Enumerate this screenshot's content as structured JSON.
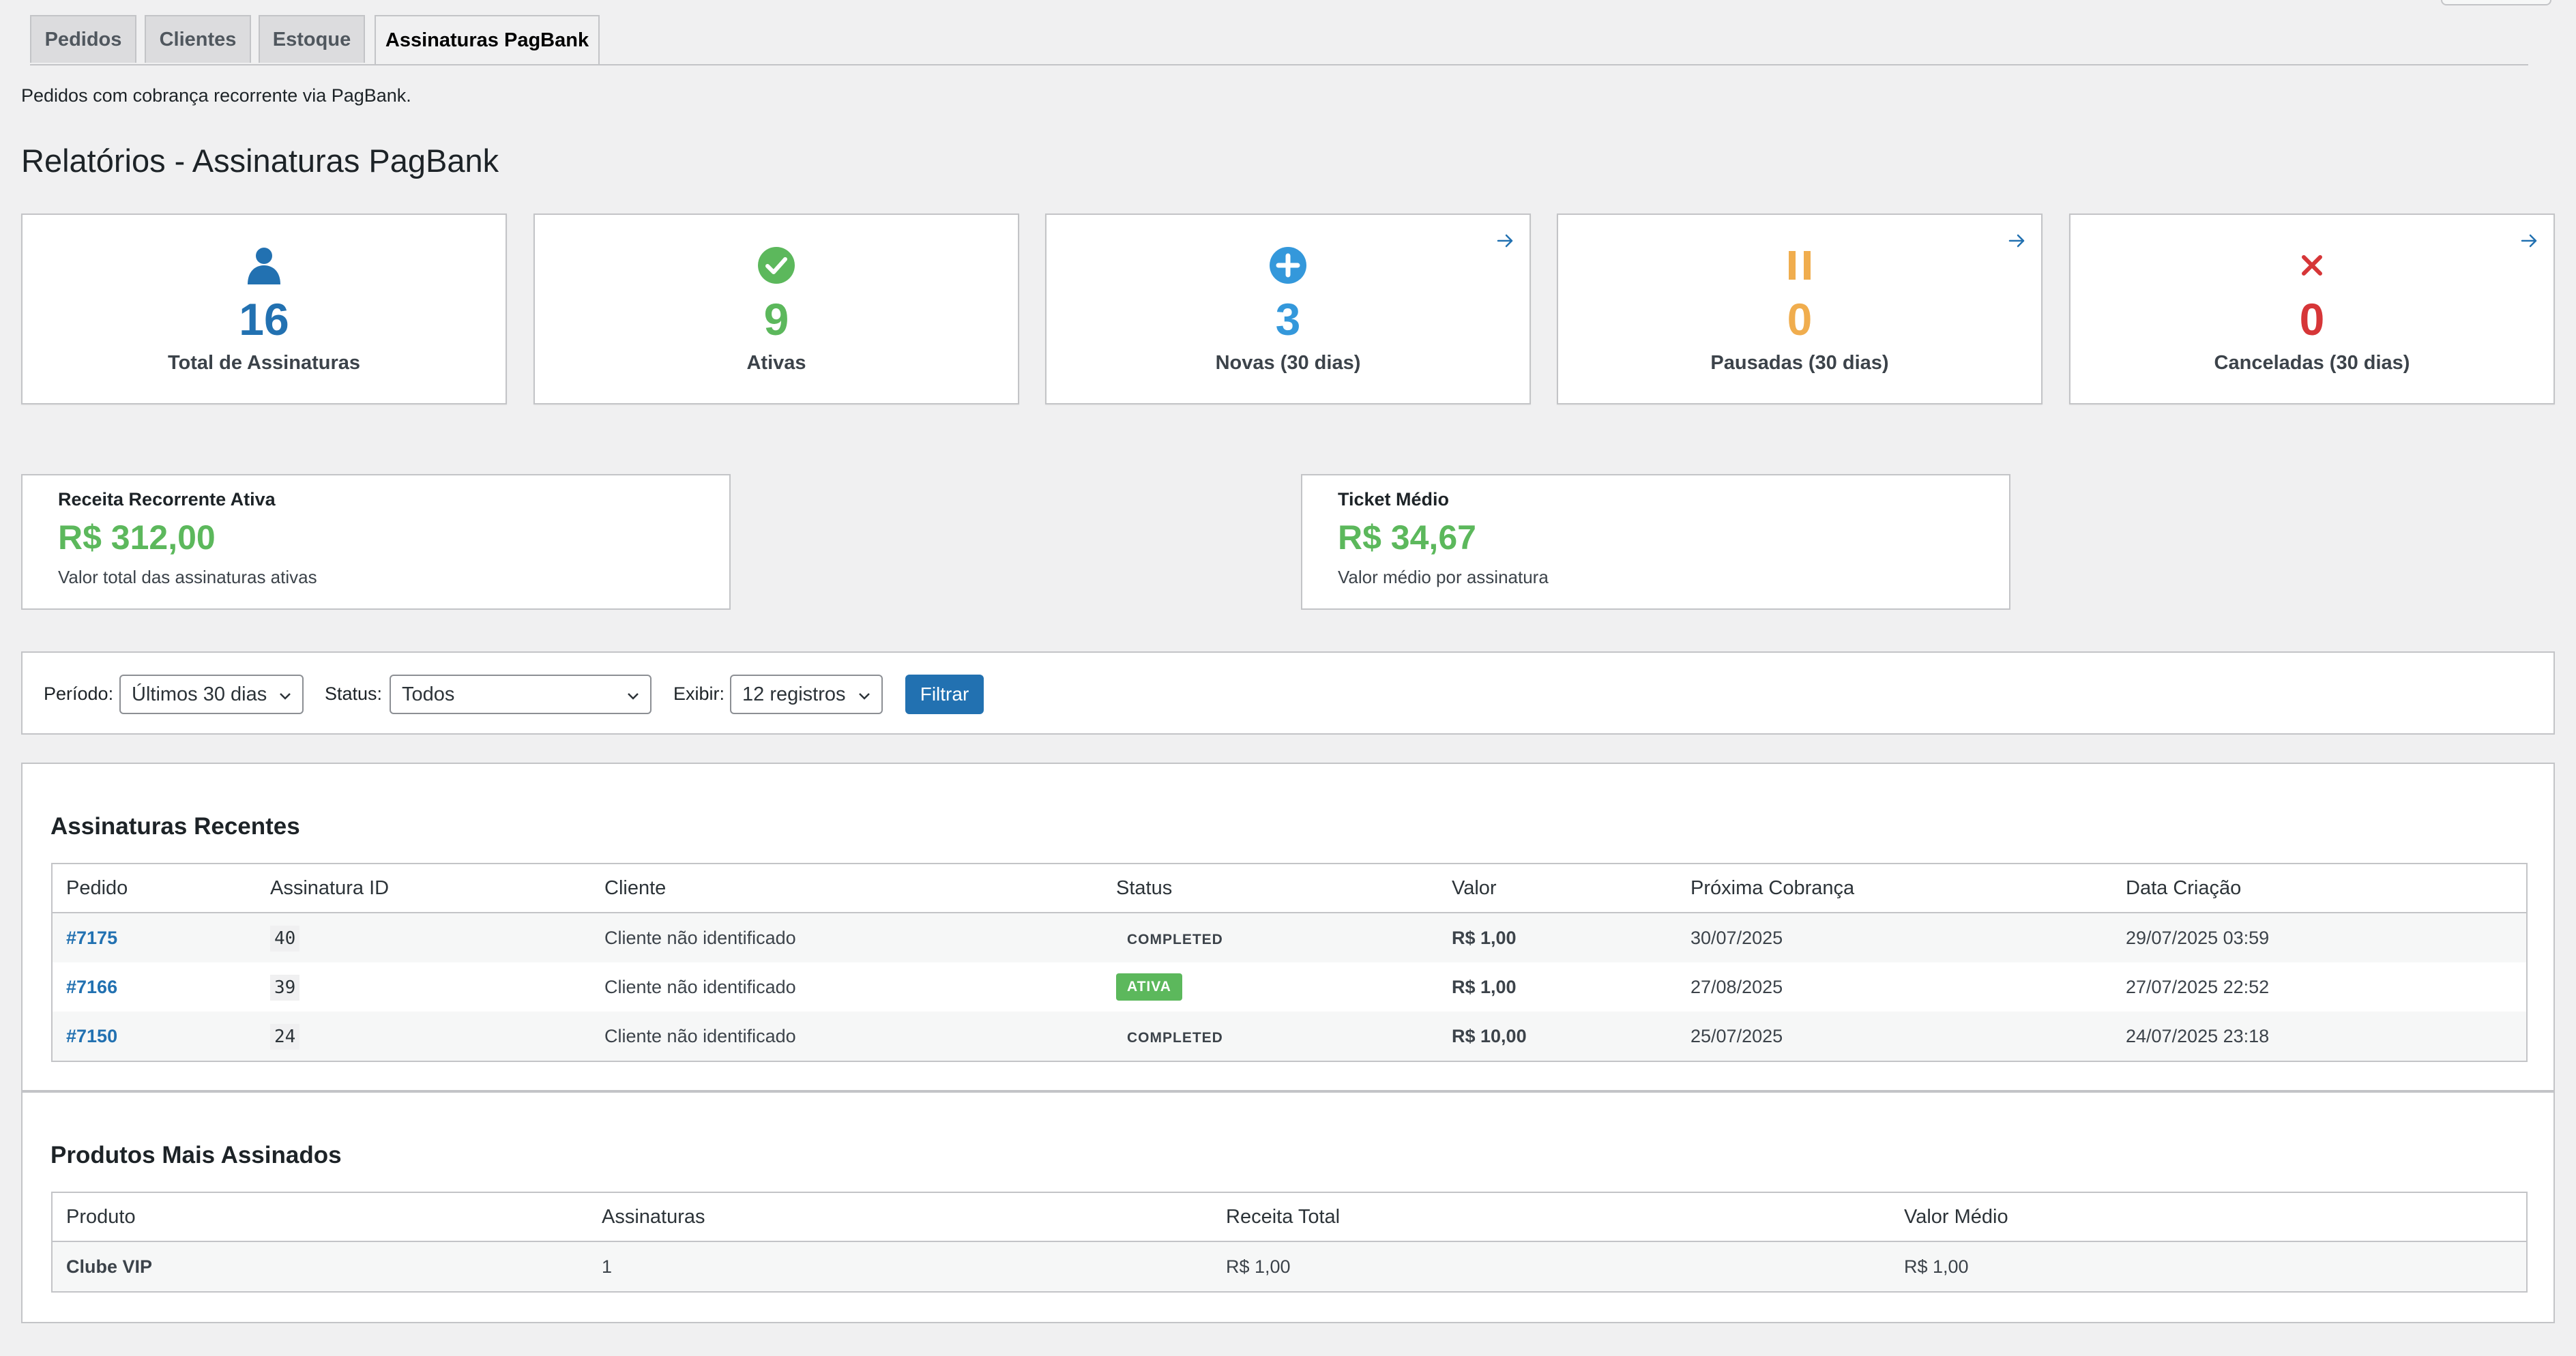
{
  "tabs": [
    {
      "label": "Pedidos"
    },
    {
      "label": "Clientes"
    },
    {
      "label": "Estoque"
    },
    {
      "label": "Assinaturas PagBank"
    }
  ],
  "description": "Pedidos com cobrança recorrente via PagBank.",
  "page_title": "Relatórios - Assinaturas PagBank",
  "stats": [
    {
      "icon": "user-icon",
      "value": "16",
      "label": "Total de Assinaturas",
      "color": "#2271b1"
    },
    {
      "icon": "check-circle-icon",
      "value": "9",
      "label": "Ativas",
      "color": "#5cb85c"
    },
    {
      "icon": "plus-circle-icon",
      "value": "3",
      "label": "Novas (30 dias)",
      "color": "#3498db"
    },
    {
      "icon": "pause-icon",
      "value": "0",
      "label": "Pausadas (30 dias)",
      "color": "#f0ad4e"
    },
    {
      "icon": "close-icon",
      "value": "0",
      "label": "Canceladas (30 dias)",
      "color": "#d63638"
    }
  ],
  "summary": {
    "revenue": {
      "label": "Receita Recorrente Ativa",
      "value": "R$ 312,00",
      "description": "Valor total das assinaturas ativas"
    },
    "ticket": {
      "label": "Ticket Médio",
      "value": "R$ 34,67",
      "description": "Valor médio por assinatura"
    }
  },
  "filters": {
    "period_label": "Período:",
    "period_value": "Últimos 30 dias",
    "status_label": "Status:",
    "status_value": "Todos",
    "show_label": "Exibir:",
    "show_value": "12 registros",
    "button": "Filtrar"
  },
  "recent": {
    "title": "Assinaturas Recentes",
    "columns": [
      "Pedido",
      "Assinatura ID",
      "Cliente",
      "Status",
      "Valor",
      "Próxima Cobrança",
      "Data Criação"
    ],
    "rows": [
      {
        "order": "#7175",
        "sub_id": "40",
        "client": "Cliente não identificado",
        "status": "COMPLETED",
        "value": "R$ 1,00",
        "next": "30/07/2025",
        "created": "29/07/2025 03:59"
      },
      {
        "order": "#7166",
        "sub_id": "39",
        "client": "Cliente não identificado",
        "status": "ATIVA",
        "value": "R$ 1,00",
        "next": "27/08/2025",
        "created": "27/07/2025 22:52"
      },
      {
        "order": "#7150",
        "sub_id": "24",
        "client": "Cliente não identificado",
        "status": "COMPLETED",
        "value": "R$ 10,00",
        "next": "25/07/2025",
        "created": "24/07/2025 23:18"
      }
    ]
  },
  "products": {
    "title": "Produtos Mais Assinados",
    "columns": [
      "Produto",
      "Assinaturas",
      "Receita Total",
      "Valor Médio"
    ],
    "rows": [
      {
        "product": "Clube VIP",
        "count": "1",
        "total": "R$ 1,00",
        "avg": "R$ 1,00"
      }
    ]
  }
}
